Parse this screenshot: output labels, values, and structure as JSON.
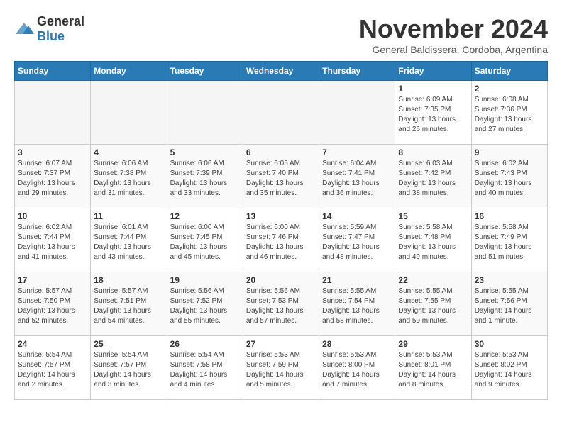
{
  "logo": {
    "general": "General",
    "blue": "Blue"
  },
  "title": "November 2024",
  "subtitle": "General Baldissera, Cordoba, Argentina",
  "days_of_week": [
    "Sunday",
    "Monday",
    "Tuesday",
    "Wednesday",
    "Thursday",
    "Friday",
    "Saturday"
  ],
  "weeks": [
    [
      {
        "day": "",
        "details": ""
      },
      {
        "day": "",
        "details": ""
      },
      {
        "day": "",
        "details": ""
      },
      {
        "day": "",
        "details": ""
      },
      {
        "day": "",
        "details": ""
      },
      {
        "day": "1",
        "details": "Sunrise: 6:09 AM\nSunset: 7:35 PM\nDaylight: 13 hours and 26 minutes."
      },
      {
        "day": "2",
        "details": "Sunrise: 6:08 AM\nSunset: 7:36 PM\nDaylight: 13 hours and 27 minutes."
      }
    ],
    [
      {
        "day": "3",
        "details": "Sunrise: 6:07 AM\nSunset: 7:37 PM\nDaylight: 13 hours and 29 minutes."
      },
      {
        "day": "4",
        "details": "Sunrise: 6:06 AM\nSunset: 7:38 PM\nDaylight: 13 hours and 31 minutes."
      },
      {
        "day": "5",
        "details": "Sunrise: 6:06 AM\nSunset: 7:39 PM\nDaylight: 13 hours and 33 minutes."
      },
      {
        "day": "6",
        "details": "Sunrise: 6:05 AM\nSunset: 7:40 PM\nDaylight: 13 hours and 35 minutes."
      },
      {
        "day": "7",
        "details": "Sunrise: 6:04 AM\nSunset: 7:41 PM\nDaylight: 13 hours and 36 minutes."
      },
      {
        "day": "8",
        "details": "Sunrise: 6:03 AM\nSunset: 7:42 PM\nDaylight: 13 hours and 38 minutes."
      },
      {
        "day": "9",
        "details": "Sunrise: 6:02 AM\nSunset: 7:43 PM\nDaylight: 13 hours and 40 minutes."
      }
    ],
    [
      {
        "day": "10",
        "details": "Sunrise: 6:02 AM\nSunset: 7:44 PM\nDaylight: 13 hours and 41 minutes."
      },
      {
        "day": "11",
        "details": "Sunrise: 6:01 AM\nSunset: 7:44 PM\nDaylight: 13 hours and 43 minutes."
      },
      {
        "day": "12",
        "details": "Sunrise: 6:00 AM\nSunset: 7:45 PM\nDaylight: 13 hours and 45 minutes."
      },
      {
        "day": "13",
        "details": "Sunrise: 6:00 AM\nSunset: 7:46 PM\nDaylight: 13 hours and 46 minutes."
      },
      {
        "day": "14",
        "details": "Sunrise: 5:59 AM\nSunset: 7:47 PM\nDaylight: 13 hours and 48 minutes."
      },
      {
        "day": "15",
        "details": "Sunrise: 5:58 AM\nSunset: 7:48 PM\nDaylight: 13 hours and 49 minutes."
      },
      {
        "day": "16",
        "details": "Sunrise: 5:58 AM\nSunset: 7:49 PM\nDaylight: 13 hours and 51 minutes."
      }
    ],
    [
      {
        "day": "17",
        "details": "Sunrise: 5:57 AM\nSunset: 7:50 PM\nDaylight: 13 hours and 52 minutes."
      },
      {
        "day": "18",
        "details": "Sunrise: 5:57 AM\nSunset: 7:51 PM\nDaylight: 13 hours and 54 minutes."
      },
      {
        "day": "19",
        "details": "Sunrise: 5:56 AM\nSunset: 7:52 PM\nDaylight: 13 hours and 55 minutes."
      },
      {
        "day": "20",
        "details": "Sunrise: 5:56 AM\nSunset: 7:53 PM\nDaylight: 13 hours and 57 minutes."
      },
      {
        "day": "21",
        "details": "Sunrise: 5:55 AM\nSunset: 7:54 PM\nDaylight: 13 hours and 58 minutes."
      },
      {
        "day": "22",
        "details": "Sunrise: 5:55 AM\nSunset: 7:55 PM\nDaylight: 13 hours and 59 minutes."
      },
      {
        "day": "23",
        "details": "Sunrise: 5:55 AM\nSunset: 7:56 PM\nDaylight: 14 hours and 1 minute."
      }
    ],
    [
      {
        "day": "24",
        "details": "Sunrise: 5:54 AM\nSunset: 7:57 PM\nDaylight: 14 hours and 2 minutes."
      },
      {
        "day": "25",
        "details": "Sunrise: 5:54 AM\nSunset: 7:57 PM\nDaylight: 14 hours and 3 minutes."
      },
      {
        "day": "26",
        "details": "Sunrise: 5:54 AM\nSunset: 7:58 PM\nDaylight: 14 hours and 4 minutes."
      },
      {
        "day": "27",
        "details": "Sunrise: 5:53 AM\nSunset: 7:59 PM\nDaylight: 14 hours and 5 minutes."
      },
      {
        "day": "28",
        "details": "Sunrise: 5:53 AM\nSunset: 8:00 PM\nDaylight: 14 hours and 7 minutes."
      },
      {
        "day": "29",
        "details": "Sunrise: 5:53 AM\nSunset: 8:01 PM\nDaylight: 14 hours and 8 minutes."
      },
      {
        "day": "30",
        "details": "Sunrise: 5:53 AM\nSunset: 8:02 PM\nDaylight: 14 hours and 9 minutes."
      }
    ]
  ]
}
